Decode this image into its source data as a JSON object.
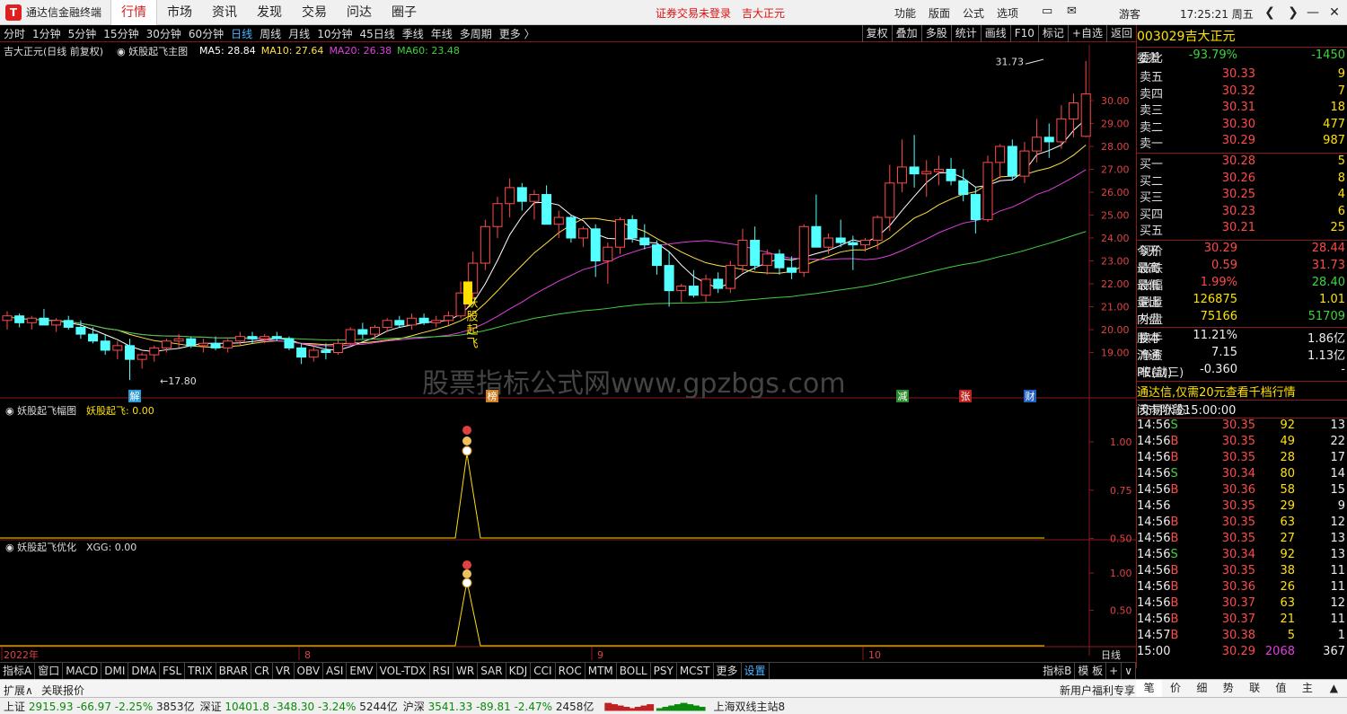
{
  "titlebar": {
    "app_name": "通达信金融终端",
    "nav": [
      "行情",
      "市场",
      "资讯",
      "发现",
      "交易",
      "问达",
      "圈子"
    ],
    "active_nav": "行情",
    "warning": "证券交易未登录",
    "stock_name": "吉大正元",
    "menu": [
      "功能",
      "版面",
      "公式",
      "选项"
    ],
    "user": "游客",
    "clock": "17:25:21 周五"
  },
  "toolbar": {
    "periods": [
      "分时",
      "1分钟",
      "5分钟",
      "15分钟",
      "30分钟",
      "60分钟",
      "日线",
      "周线",
      "月线",
      "10分钟",
      "45日线",
      "季线",
      "年线",
      "多周期",
      "更多"
    ],
    "active": "日线",
    "right": [
      "复权",
      "叠加",
      "多股",
      "统计",
      "画线",
      "F10",
      "标记",
      "+自选",
      "返回"
    ]
  },
  "main_chart": {
    "title": "吉大正元(日线 前复权)",
    "indicator": "妖股起飞主图",
    "ma": [
      {
        "label": "MA5: 28.84",
        "color": "#ffffff"
      },
      {
        "label": "MA10: 27.64",
        "color": "#ffe040"
      },
      {
        "label": "MA20: 26.38",
        "color": "#e040e0"
      },
      {
        "label": "MA60: 23.48",
        "color": "#40d040"
      }
    ],
    "yticks": [
      "30.00",
      "29.00",
      "28.00",
      "27.00",
      "26.00",
      "25.00",
      "24.00",
      "23.00",
      "22.00",
      "21.00",
      "20.00",
      "19.00"
    ],
    "high_label": "31.73",
    "low_label": "17.80",
    "signal_text": [
      "妖",
      "股",
      "起",
      "飞"
    ],
    "watermark": "股票指标公式网www.gpzbgs.com",
    "markers": [
      {
        "t": "解",
        "color": "#2a9ad8",
        "xi": 0
      },
      {
        "t": "榜",
        "color": "#d08020",
        "xi": 1
      },
      {
        "t": "减",
        "color": "#2a8a2a",
        "xi": 2
      },
      {
        "t": "张",
        "color": "#c02020",
        "xi": 3
      },
      {
        "t": "财",
        "color": "#2060c0",
        "xi": 4
      }
    ]
  },
  "sub1": {
    "title": "妖股起飞幅图",
    "value_label": "妖股起飞: 0.00",
    "yticks": [
      "1.00",
      "0.75",
      "0.50"
    ]
  },
  "sub2": {
    "title": "妖股起飞优化",
    "value_label": "XGG: 0.00",
    "yticks": [
      "1.00",
      "0.50"
    ]
  },
  "xaxis": {
    "labels": [
      "2022年",
      "8",
      "9",
      "10"
    ],
    "period": "日线"
  },
  "bottom_tabs": [
    "指标A",
    "窗口",
    "MACD",
    "DMI",
    "DMA",
    "FSL",
    "TRIX",
    "BRAR",
    "CR",
    "VR",
    "OBV",
    "ASI",
    "EMV",
    "VOL-TDX",
    "RSI",
    "WR",
    "SAR",
    "KDJ",
    "CCI",
    "ROC",
    "MTM",
    "BOLL",
    "PSY",
    "MCST",
    "更多",
    "设置"
  ],
  "bottom_tabs_right": [
    "指标B",
    "模 板",
    "+",
    "∨"
  ],
  "ext_bar": {
    "expand": "扩展∧",
    "related": "关联报价",
    "promo": "新用户福利专享"
  },
  "quote": {
    "code": "003029",
    "name": "吉大正元",
    "webi": {
      "label": "委比",
      "value": "-93.79%",
      "label2": "委差",
      "value2": "-1450"
    },
    "asks": [
      {
        "l": "卖五",
        "p": "30.33",
        "v": "9"
      },
      {
        "l": "卖四",
        "p": "30.32",
        "v": "7"
      },
      {
        "l": "卖三",
        "p": "30.31",
        "v": "18"
      },
      {
        "l": "卖二",
        "p": "30.30",
        "v": "477"
      },
      {
        "l": "卖一",
        "p": "30.29",
        "v": "987"
      }
    ],
    "bids": [
      {
        "l": "买一",
        "p": "30.28",
        "v": "5"
      },
      {
        "l": "买二",
        "p": "30.26",
        "v": "8"
      },
      {
        "l": "买三",
        "p": "30.25",
        "v": "4"
      },
      {
        "l": "买四",
        "p": "30.23",
        "v": "6"
      },
      {
        "l": "买五",
        "p": "30.21",
        "v": "25"
      }
    ],
    "stats": [
      {
        "l": "现价",
        "v": "30.29",
        "l2": "今开",
        "v2": "28.44"
      },
      {
        "l": "涨跌",
        "v": "0.59",
        "l2": "最高",
        "v2": "31.73"
      },
      {
        "l": "涨幅",
        "v": "1.99%",
        "l2": "最低",
        "v2": "28.40"
      },
      {
        "l": "总量",
        "v": "126875",
        "l2": "量比",
        "v2": "1.01"
      },
      {
        "l": "外盘",
        "v": "75166",
        "l2": "内盘",
        "v2": "51709"
      }
    ],
    "stats2": [
      {
        "l": "换手",
        "v": "11.21%",
        "l2": "股本",
        "v2": "1.86亿"
      },
      {
        "l": "净资",
        "v": "7.15",
        "l2": "流通",
        "v2": "1.13亿"
      },
      {
        "l": "收益(三)",
        "v": "-0.360",
        "l2": "PE(动)",
        "v2": "-"
      }
    ],
    "promo": "通达信,仅需20元查看千档行情",
    "state_label": "交易状态:",
    "state": "闭市阶段",
    "state_time": "15:00:00",
    "ticks": [
      [
        "14:56",
        "30.35",
        "92",
        "S",
        "13"
      ],
      [
        "14:56",
        "30.35",
        "49",
        "B",
        "22"
      ],
      [
        "14:56",
        "30.35",
        "28",
        "B",
        "17"
      ],
      [
        "14:56",
        "30.34",
        "80",
        "S",
        "14"
      ],
      [
        "14:56",
        "30.36",
        "58",
        "B",
        "15"
      ],
      [
        "14:56",
        "30.35",
        "29",
        "",
        "9"
      ],
      [
        "14:56",
        "30.35",
        "63",
        "B",
        "12"
      ],
      [
        "14:56",
        "30.35",
        "27",
        "B",
        "13"
      ],
      [
        "14:56",
        "30.34",
        "92",
        "S",
        "13"
      ],
      [
        "14:56",
        "30.35",
        "38",
        "B",
        "11"
      ],
      [
        "14:56",
        "30.36",
        "26",
        "B",
        "11"
      ],
      [
        "14:56",
        "30.37",
        "63",
        "B",
        "12"
      ],
      [
        "14:56",
        "30.37",
        "21",
        "B",
        "11"
      ],
      [
        "14:57",
        "30.38",
        "5",
        "B",
        "1"
      ],
      [
        "15:00",
        "30.29",
        "2068",
        "",
        "367"
      ]
    ],
    "tabs": [
      "笔",
      "价",
      "细",
      "势",
      "联",
      "值",
      "主",
      "▲"
    ]
  },
  "statusbar": {
    "items": [
      {
        "n": "上证",
        "v": "2915.93",
        "c": "-66.97",
        "p": "-2.25%",
        "a": "3853亿"
      },
      {
        "n": "深证",
        "v": "10401.8",
        "c": "-348.30",
        "p": "-3.24%",
        "a": "5244亿"
      },
      {
        "n": "沪深",
        "v": "3541.33",
        "c": "-89.81",
        "p": "-2.47%",
        "a": "2458亿"
      }
    ],
    "server": "上海双线主站8"
  }
}
